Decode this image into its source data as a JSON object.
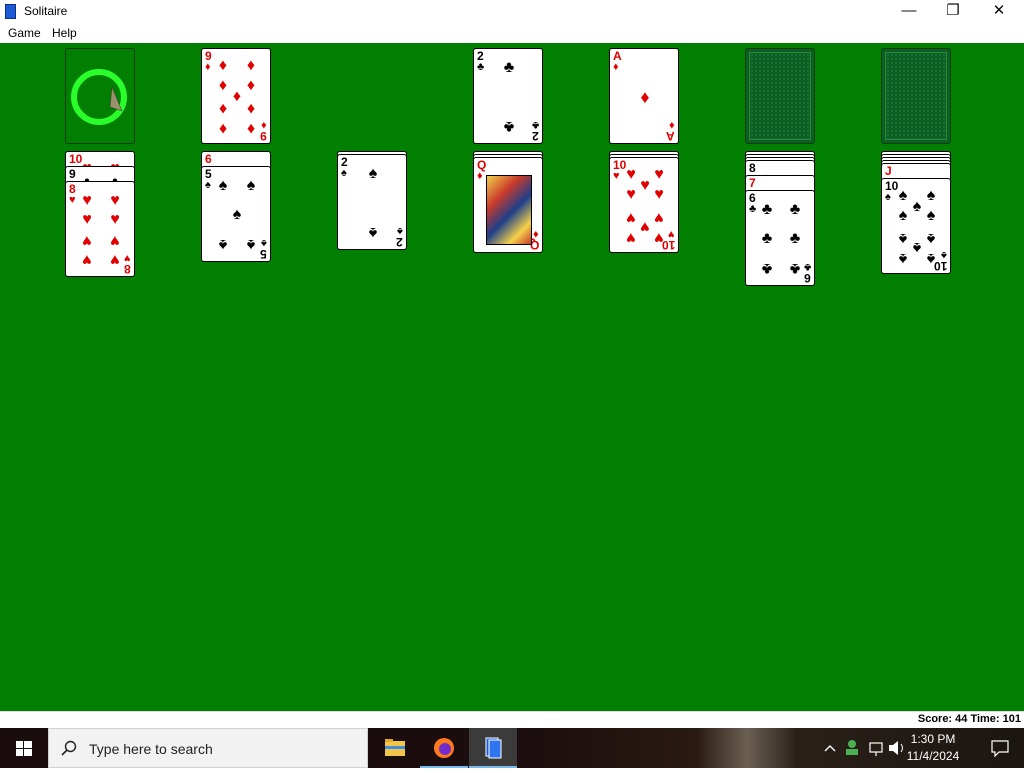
{
  "window": {
    "title": "Solitaire",
    "minimize": "—",
    "restore": "❐",
    "close": "✕"
  },
  "menu": {
    "items": [
      "Game",
      "Help"
    ]
  },
  "status": {
    "score_text": "Score: 44  Time: 101"
  },
  "taskbar": {
    "search_placeholder": "Type here to search",
    "clock_time": "1:30 PM",
    "clock_date": "11/4/2024"
  },
  "colors": {
    "felt": "#007f00",
    "red_suit": "#e00000",
    "black_suit": "#000000",
    "card_back": "#0b5e24"
  },
  "game": {
    "stock": {
      "state": "empty",
      "icon": "redeal-circle-icon"
    },
    "waste": {
      "top_card": {
        "rank": "9",
        "suit": "diamonds"
      }
    },
    "foundations": [
      {
        "top_card": {
          "rank": "2",
          "suit": "clubs"
        }
      },
      {
        "top_card": {
          "rank": "A",
          "suit": "diamonds"
        }
      },
      {
        "top_card": null,
        "face_down": true
      },
      {
        "top_card": null,
        "face_down": true
      }
    ],
    "tableau": [
      {
        "face_down": 0,
        "face_up": [
          {
            "rank": "10",
            "suit": "hearts"
          },
          {
            "rank": "9",
            "suit": "clubs"
          },
          {
            "rank": "8",
            "suit": "hearts"
          }
        ]
      },
      {
        "face_down": 0,
        "face_up": [
          {
            "rank": "6",
            "suit": "diamonds"
          },
          {
            "rank": "5",
            "suit": "spades"
          }
        ]
      },
      {
        "face_down": 1,
        "face_up": [
          {
            "rank": "2",
            "suit": "spades"
          }
        ]
      },
      {
        "face_down": 2,
        "face_up": [
          {
            "rank": "Q",
            "suit": "diamonds"
          }
        ]
      },
      {
        "face_down": 2,
        "face_up": [
          {
            "rank": "10",
            "suit": "hearts"
          }
        ]
      },
      {
        "face_down": 3,
        "face_up": [
          {
            "rank": "8",
            "suit": "spades"
          },
          {
            "rank": "7",
            "suit": "hearts"
          },
          {
            "rank": "6",
            "suit": "clubs"
          }
        ]
      },
      {
        "face_down": 4,
        "face_up": [
          {
            "rank": "J",
            "suit": "hearts"
          },
          {
            "rank": "10",
            "suit": "spades"
          }
        ]
      }
    ]
  }
}
